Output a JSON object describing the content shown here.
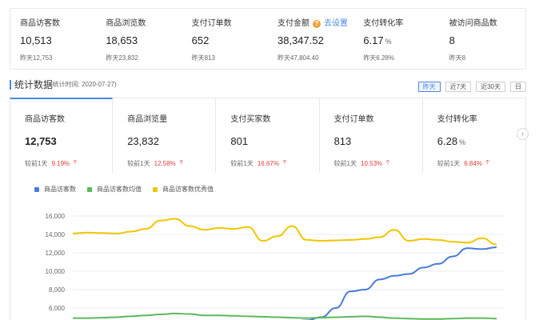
{
  "summary": [
    {
      "label": "商品访客数",
      "value": "10,513",
      "unit": "",
      "sub": "昨天12,753",
      "help": false
    },
    {
      "label": "商品浏览数",
      "value": "18,653",
      "unit": "",
      "sub": "昨天23,832",
      "help": false
    },
    {
      "label": "支付订单数",
      "value": "652",
      "unit": "",
      "sub": "昨天813",
      "help": false
    },
    {
      "label": "支付金额",
      "value": "38,347.52",
      "unit": "",
      "sub": "昨天47,804.40",
      "help": true,
      "link": "去设置"
    },
    {
      "label": "支付转化率",
      "value": "6.17",
      "unit": "%",
      "sub": "昨天6.28%",
      "help": false
    },
    {
      "label": "被访问商品数",
      "value": "8",
      "unit": "",
      "sub": "昨天8",
      "help": false
    }
  ],
  "section": {
    "title": "统计数据",
    "date": "(统计时间: 2020-07-27)",
    "ranges": [
      {
        "label": "昨天",
        "active": true
      },
      {
        "label": "近7天",
        "active": false
      },
      {
        "label": "近30天",
        "active": false
      },
      {
        "label": "日",
        "active": false
      }
    ]
  },
  "metrics": [
    {
      "label": "商品访客数",
      "value": "12,753",
      "unit": "",
      "compare": "较前1天",
      "pct": "9.19%",
      "active": true
    },
    {
      "label": "商品浏览量",
      "value": "23,832",
      "unit": "",
      "compare": "较前1天",
      "pct": "12.58%",
      "active": false
    },
    {
      "label": "支付买家数",
      "value": "801",
      "unit": "",
      "compare": "较前1天",
      "pct": "16.67%",
      "active": false
    },
    {
      "label": "支付订单数",
      "value": "813",
      "unit": "",
      "compare": "较前1天",
      "pct": "10.53%",
      "active": false
    },
    {
      "label": "支付转化率",
      "value": "6.28",
      "unit": "%",
      "compare": "较前1天",
      "pct": "6.84%",
      "active": false
    }
  ],
  "chart_data": {
    "type": "line",
    "y_ticks": [
      "16,000",
      "14,000",
      "12,000",
      "10,000",
      "8,000",
      "6,000"
    ],
    "y_tick_values": [
      16000,
      14000,
      12000,
      10000,
      8000,
      6000
    ],
    "grid": true,
    "legend_position": "top-left",
    "series": [
      {
        "name": "商品访客数",
        "color": "#4a7bd8",
        "values": [
          4100,
          4200,
          4250,
          4300,
          4200,
          4250,
          4300,
          4200,
          4150,
          4250,
          4200,
          4200,
          4300,
          4500,
          4400,
          4500,
          4650,
          5000,
          6000,
          7800,
          8000,
          9100,
          9500,
          9700,
          10400,
          10800,
          11600,
          12500,
          12400,
          12600
        ]
      },
      {
        "name": "商品访客数均值",
        "color": "#5cb85c",
        "values": [
          4900,
          4900,
          4950,
          5000,
          5100,
          5200,
          5300,
          5400,
          5350,
          5200,
          5200,
          5150,
          5100,
          5050,
          5000,
          4950,
          4900,
          4950,
          5000,
          5050,
          5100,
          5000,
          4900,
          4850,
          4800,
          4800,
          4850,
          4900,
          4900,
          4850
        ]
      },
      {
        "name": "商品访客数优秀值",
        "color": "#f2c500",
        "values": [
          14100,
          14200,
          14150,
          14100,
          14300,
          14600,
          15500,
          15700,
          14900,
          14500,
          14700,
          14600,
          14800,
          13300,
          13800,
          14900,
          13400,
          13300,
          13350,
          13400,
          13500,
          13700,
          14500,
          13300,
          13500,
          13400,
          13200,
          13100,
          13600,
          12900
        ]
      }
    ]
  }
}
